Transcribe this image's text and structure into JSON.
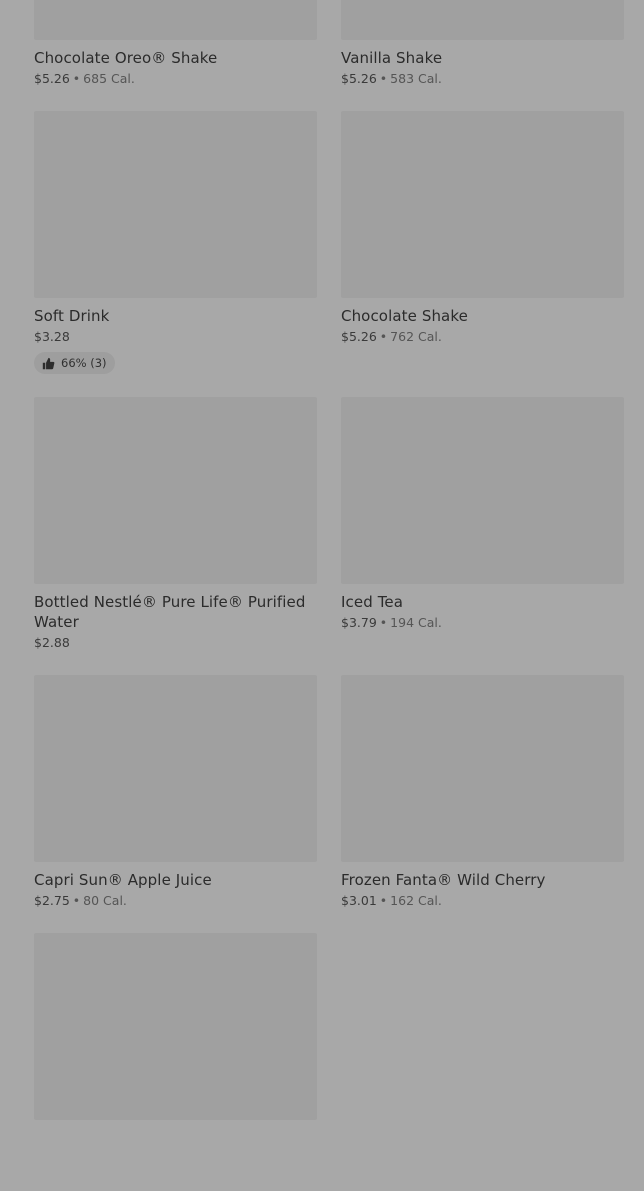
{
  "items": [
    {
      "name": "Chocolate Oreo® Shake",
      "price": "$5.26",
      "sep": "•",
      "cal": "685 Cal."
    },
    {
      "name": "Vanilla Shake",
      "price": "$5.26",
      "sep": "•",
      "cal": "583 Cal."
    },
    {
      "name": "Soft Drink",
      "price": "$3.28",
      "sep": "",
      "cal": "",
      "rating": "66% (3)"
    },
    {
      "name": "Chocolate Shake",
      "price": "$5.26",
      "sep": "•",
      "cal": "762 Cal."
    },
    {
      "name": "Bottled Nestlé® Pure Life® Purified Water",
      "price": "$2.88",
      "sep": "",
      "cal": ""
    },
    {
      "name": "Iced Tea",
      "price": "$3.79",
      "sep": "•",
      "cal": "194 Cal."
    },
    {
      "name": "Capri Sun® Apple Juice",
      "price": "$2.75",
      "sep": "•",
      "cal": "80 Cal."
    },
    {
      "name": "Frozen Fanta® Wild Cherry",
      "price": "$3.01",
      "sep": "•",
      "cal": "162 Cal."
    }
  ],
  "icons": {
    "rating": "thumbs-up-icon"
  }
}
